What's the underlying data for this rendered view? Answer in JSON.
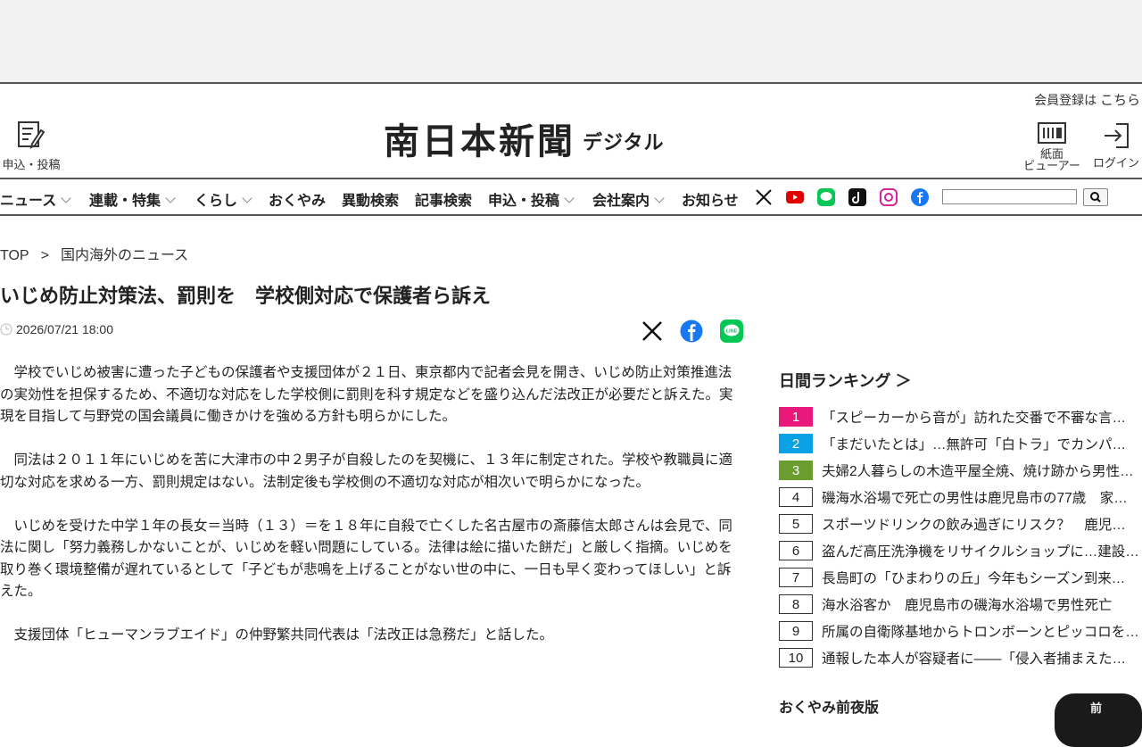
{
  "header": {
    "member_text": "会員登録は",
    "member_link": "こちら",
    "apply_label": "申込・投稿",
    "logo_main": "南日本新聞",
    "logo_sub": "デジタル",
    "viewer_label_1": "紙面",
    "viewer_label_2": "ビューアー",
    "login_label": "ログイン"
  },
  "nav": {
    "items": [
      "ニュース",
      "連載・特集",
      "くらし",
      "おくやみ",
      "異動検索",
      "記事検索",
      "申込・投稿",
      "会社案内",
      "お知らせ"
    ],
    "social": [
      "x-icon",
      "youtube-icon",
      "line-icon",
      "tiktok-icon",
      "instagram-icon",
      "facebook-icon"
    ],
    "colors": {
      "youtube": "#e00000",
      "line": "#06c755",
      "tiktok": "#111111",
      "instagram": "#d6249f",
      "facebook": "#1877f2"
    }
  },
  "breadcrumb": {
    "top": "TOP",
    "sep": ">",
    "current": "国内海外のニュース"
  },
  "article": {
    "title": "いじめ防止対策法、罰則を　学校側対応で保護者ら訴え",
    "date": "2026/07/21 18:00",
    "paragraphs": [
      "学校でいじめ被害に遭った子どもの保護者や支援団体が２１日、東京都内で記者会見を開き、いじめ防止対策推進法の実効性を担保するため、不適切な対応をした学校側に罰則を科す規定などを盛り込んだ法改正が必要だと訴えた。実現を目指して与野党の国会議員に働きかけを強める方針も明らかにした。",
      "同法は２０１１年にいじめを苦に大津市の中２男子が自殺したのを契機に、１３年に制定された。学校や教職員に適切な対応を求める一方、罰則規定はない。法制定後も学校側の不適切な対応が相次いで明らかになった。",
      "いじめを受けた中学１年の長女＝当時（１３）＝を１８年に自殺で亡くした名古屋市の斎藤信太郎さんは会見で、同法に関し「努力義務しかないことが、いじめを軽い問題にしている。法律は絵に描いた餅だ」と厳しく指摘。いじめを取り巻く環境整備が遅れているとして「子どもが悲鳴を上げることがない世の中に、一日も早く変わってほしい」と訴えた。",
      "支援団体「ヒューマンラブエイド」の仲野繁共同代表は「法改正は急務だ」と話した。"
    ]
  },
  "ranking": {
    "heading": "日間ランキング ＞",
    "items": [
      {
        "rank": "1",
        "text": "「スピーカーから音が」訪れた交番で不審な言動…"
      },
      {
        "rank": "2",
        "text": "「まだいたとは」…無許可「白トラ」でカンパニー…"
      },
      {
        "rank": "3",
        "text": "夫婦2人暮らしの木造平屋全焼、焼け跡から男性…"
      },
      {
        "rank": "4",
        "text": "磯海水浴場で死亡の男性は鹿児島市の77歳　家族…"
      },
      {
        "rank": "5",
        "text": "スポーツドリンクの飲み過ぎにリスク？　鹿児島…"
      },
      {
        "rank": "6",
        "text": "盗んだ高圧洗浄機をリサイクルショップに…建設…"
      },
      {
        "rank": "7",
        "text": "長島町の「ひまわりの丘」今年もシーズン到来…"
      },
      {
        "rank": "8",
        "text": "海水浴客か　鹿児島市の磯海水浴場で男性死亡"
      },
      {
        "rank": "9",
        "text": "所属の自衛隊基地からトロンボーンとピッコロを…"
      },
      {
        "rank": "10",
        "text": "通報した本人が容疑者に――「侵入者捕まえた」…"
      }
    ],
    "top_colors": [
      "#e8197a",
      "#0aa0e6",
      "#6a9c2e"
    ],
    "okuyami_heading": "おくやみ前夜版",
    "okuyami_badge": "前"
  }
}
